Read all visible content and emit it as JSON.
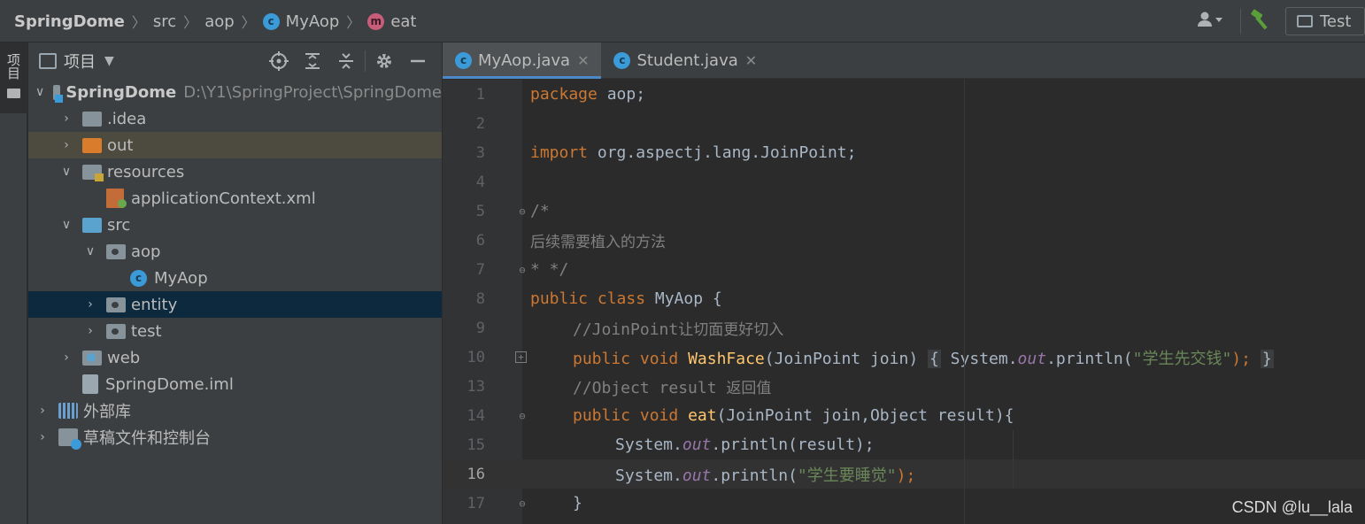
{
  "breadcrumb": {
    "project": "SpringDome",
    "src": "src",
    "package": "aop",
    "class": "MyAop",
    "method": "eat"
  },
  "toolbar": {
    "run_config": "Test"
  },
  "toolstrip": {
    "project_tab": "项目"
  },
  "project_panel": {
    "title": "项目",
    "tree": {
      "root_name": "SpringDome",
      "root_path": "D:\\Y1\\SpringProject\\SpringDome",
      "idea": ".idea",
      "out": "out",
      "resources": "resources",
      "app_context": "applicationContext.xml",
      "src": "src",
      "aop": "aop",
      "myaop": "MyAop",
      "entity": "entity",
      "test": "test",
      "web": "web",
      "iml": "SpringDome.iml",
      "external_libs": "外部库",
      "scratches": "草稿文件和控制台"
    }
  },
  "editor": {
    "tabs": [
      {
        "label": "MyAop.java",
        "active": true
      },
      {
        "label": "Student.java",
        "active": false
      }
    ],
    "line_numbers": [
      "1",
      "2",
      "3",
      "4",
      "5",
      "6",
      "7",
      "8",
      "9",
      "10",
      "13",
      "14",
      "15",
      "16",
      "17"
    ],
    "current_line": "16",
    "code": {
      "l1_kw": "package",
      "l1_rest": " aop;",
      "l3_kw": "import",
      "l3_rest": " org.aspectj.lang.JoinPoint;",
      "l5": "/*",
      "l6": "后续需要植入的方法",
      "l7": "* */",
      "l8_kw": "public class",
      "l8_rest": " MyAop {",
      "l9_prefix": "//JoinPoint",
      "l9_cn": "让切面更好切入",
      "l10_kw": "public void",
      "l10_fn": "WashFace",
      "l10_args": "(JoinPoint join)",
      "l10_open": "{",
      "l10_body1": " System.",
      "l10_out": "out",
      "l10_body2": ".println(",
      "l10_str": "\"学生先交钱\"",
      "l10_end": ");",
      "l10_close": "}",
      "l13_prefix": "//Object result ",
      "l13_cn": "返回值",
      "l14_kw": "public void",
      "l14_fn": "eat",
      "l14_args": "(JoinPoint join,Object result){",
      "l15_a": "System.",
      "l15_out": "out",
      "l15_b": ".println(result);",
      "l16_a": "System.",
      "l16_out": "out",
      "l16_b": ".println(",
      "l16_str": "\"学生要睡觉\"",
      "l16_end": ");",
      "l17": "}"
    }
  },
  "watermark": "CSDN @lu__lala",
  "colors": {
    "keyword": "#cc7832",
    "function": "#ffc66d",
    "string": "#6a8759",
    "comment": "#808080",
    "static_field": "#9876aa",
    "selection": "#0d293e",
    "tab_underline": "#4a88c7"
  }
}
